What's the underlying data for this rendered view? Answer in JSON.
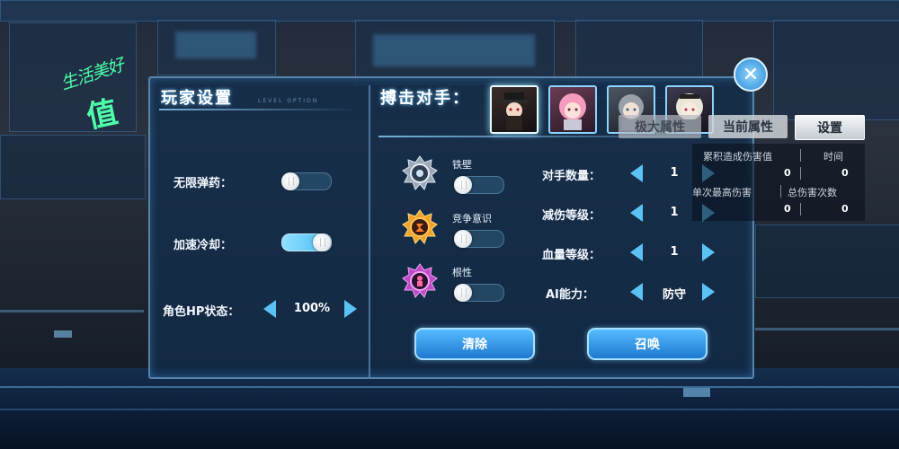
{
  "watermark": {
    "line1": "生活美好",
    "line2": "值"
  },
  "player_settings": {
    "title": "玩家设置",
    "subtitle": "LEVEL OPTION",
    "infinite_ammo": {
      "label": "无限弹药：",
      "on": false
    },
    "fast_cooldown": {
      "label": "加速冷却：",
      "on": true
    },
    "hp_state": {
      "label": "角色HP状态：",
      "value": "100%"
    }
  },
  "opponent": {
    "title": "搏击对手：",
    "portraits": [
      "opponent-1",
      "opponent-2",
      "opponent-3",
      "opponent-4"
    ],
    "selected_index": 0,
    "skills": [
      {
        "label": "铁壁",
        "icon": "iron-wall-icon",
        "on": false
      },
      {
        "label": "竞争意识",
        "icon": "competition-icon",
        "on": false
      },
      {
        "label": "根性",
        "icon": "guts-icon",
        "on": false
      }
    ],
    "params": [
      {
        "label": "对手数量：",
        "value": "1"
      },
      {
        "label": "减伤等级：",
        "value": "1"
      },
      {
        "label": "血量等级：",
        "value": "1"
      },
      {
        "label": "AI能力：",
        "value": "防守"
      }
    ],
    "clear_button": "清除",
    "summon_button": "召唤"
  },
  "tabs": {
    "tab1": "极大属性",
    "tab2": "当前属性",
    "tab3": "设置"
  },
  "stats": {
    "cumulative_damage_label": "累积造成伤害值",
    "time_label": "时间",
    "cumulative_damage": "0",
    "time": "0",
    "max_single_label": "单次最高伤害",
    "total_hits_label": "总伤害次数",
    "max_single": "0",
    "total_hits": "0"
  },
  "colors": {
    "accent": "#5bc2f5",
    "panel": "#122d4b",
    "watermark": "#4dffa8"
  }
}
